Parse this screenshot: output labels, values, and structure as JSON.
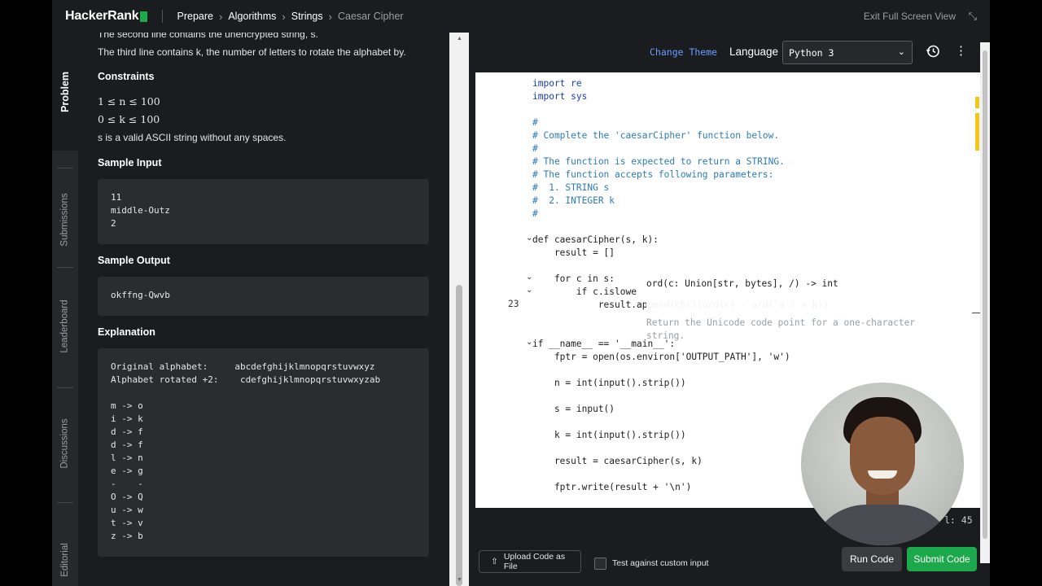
{
  "topbar": {
    "brand": "HackerRank",
    "crumbs": [
      "Prepare",
      "Algorithms",
      "Strings",
      "Caesar Cipher"
    ],
    "exit_label": "Exit Full Screen View"
  },
  "side_tabs": [
    "Problem",
    "Submissions",
    "Leaderboard",
    "Discussions",
    "Editorial"
  ],
  "problem": {
    "line_partial": "The second line contains the unencrypted string, s.",
    "line_third": "The third line contains k, the number of letters to rotate the alphabet by.",
    "constraints_heading": "Constraints",
    "constraint_1": "1 ≤ n ≤ 100",
    "constraint_2": "0 ≤ k ≤ 100",
    "constraint_3": "s is a valid ASCII string without any spaces.",
    "sample_input_heading": "Sample Input",
    "sample_input": "11\nmiddle-Outz\n2",
    "sample_output_heading": "Sample Output",
    "sample_output": "okffng-Qwvb",
    "explanation_heading": "Explanation",
    "explanation": "Original alphabet:     abcdefghijklmnopqrstuvwxyz\nAlphabet rotated +2:    cdefghijklmnopqrstuvwxyzab\n\nm -> o\ni -> k\nd -> f\nd -> f\nl -> n\ne -> g\n-    -\nO -> Q\nu -> w\nt -> v\nz -> b"
  },
  "editor": {
    "change_theme": "Change Theme",
    "language_label": "Language",
    "language_value": "Python 3",
    "code_lines": {
      "l1": "import re",
      "l2": "import sys",
      "c0": "#",
      "c1": "# Complete the 'caesarCipher' function below.",
      "c2": "#",
      "c3": "# The function is expected to return a STRING.",
      "c4": "# The function accepts following parameters:",
      "c5": "#  1. STRING s",
      "c6": "#  2. INTEGER k",
      "c7": "#",
      "def": "def caesarCipher(s, k):",
      "result": "    result = []",
      "for": "    for c in s:",
      "if": "        if c.islowe",
      "append": "            result.append(chr((ord(c) - ord('a') + k))",
      "main": "if __name__ == '__main__':",
      "fptr": "    fptr = open(os.environ['OUTPUT_PATH'], 'w')",
      "n": "    n = int(input().strip())",
      "s": "    s = input()",
      "k": "    k = int(input().strip())",
      "res": "    result = caesarCipher(s, k)",
      "write": "    fptr.write(result + '\\n')"
    },
    "line_number": "23",
    "tooltip_sig": "ord(c: Union[str, bytes], /) -> int",
    "tooltip_doc": "Return the Unicode code point for a one-character\nstring.",
    "cursor_pos": "l: 45",
    "upload_label": "Upload Code as File",
    "custom_input_label": "Test against custom input",
    "run_label": "Run Code",
    "submit_label": "Submit Code"
  },
  "colors": {
    "brand_green": "#1ba94c",
    "link_blue": "#6b9dff",
    "comment_blue": "#2c7bb7"
  }
}
